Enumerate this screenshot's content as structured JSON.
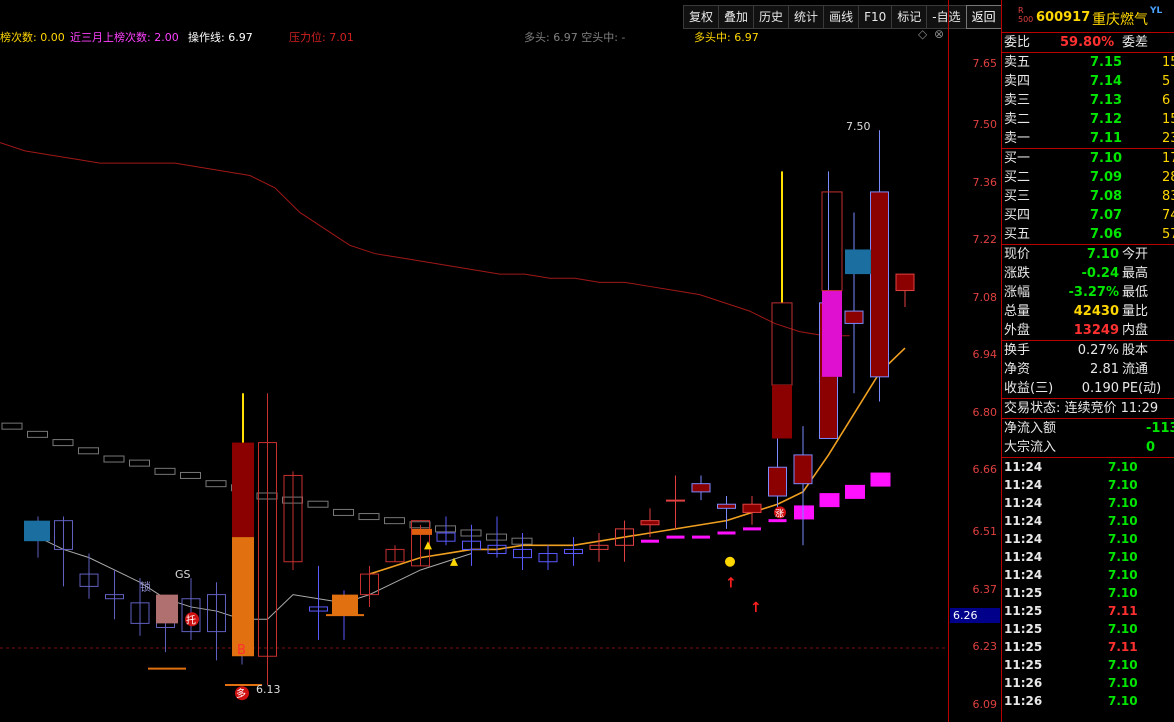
{
  "toolbar": [
    "复权",
    "叠加",
    "历史",
    "统计",
    "画线",
    "F10",
    "标记",
    "-自选",
    "返回"
  ],
  "indicators": [
    {
      "label": "榜次数: 0.00",
      "color": "#ffd700"
    },
    {
      "label": "近三月上榜次数: 2.00",
      "color": "#ff40ff"
    },
    {
      "label": "操作线: 6.97",
      "color": "#ffffff"
    },
    {
      "label": "压力位: 7.01",
      "color": "#d02020"
    },
    {
      "label": "多头: 6.97 空头中: -",
      "color": "#808080"
    },
    {
      "label": "多头中: 6.97",
      "color": "#ffd700"
    }
  ],
  "chart_icons": {
    "expand": "diamond-icon",
    "close": "close-circle-icon"
  },
  "y_axis": [
    "7.65",
    "7.50",
    "7.36",
    "7.22",
    "7.08",
    "6.94",
    "6.80",
    "6.66",
    "6.51",
    "6.37",
    "6.23",
    "6.09"
  ],
  "current_price_label": "6.26",
  "annotations": {
    "high": "7.50",
    "low": "6.13",
    "b_marker": "B",
    "gs_label": "GS",
    "tuo_label": "托",
    "suo_label": "锁",
    "zhang_label": "涨",
    "duo_label": "多"
  },
  "chart_data": {
    "type": "candlestick",
    "ylim": [
      6.05,
      7.7
    ],
    "candles": [
      {
        "o": 6.51,
        "h": 6.55,
        "l": 6.45,
        "c": 6.5
      },
      {
        "o": 6.54,
        "h": 6.55,
        "l": 6.38,
        "c": 6.47
      },
      {
        "o": 6.41,
        "h": 6.46,
        "l": 6.35,
        "c": 6.38
      },
      {
        "o": 6.36,
        "h": 6.42,
        "l": 6.3,
        "c": 6.35
      },
      {
        "o": 6.34,
        "h": 6.4,
        "l": 6.26,
        "c": 6.29
      },
      {
        "o": 6.28,
        "h": 6.35,
        "l": 6.22,
        "c": 6.3
      },
      {
        "o": 6.35,
        "h": 6.4,
        "l": 6.25,
        "c": 6.27
      },
      {
        "o": 6.27,
        "h": 6.39,
        "l": 6.2,
        "c": 6.36
      },
      {
        "o": 6.32,
        "h": 6.35,
        "l": 6.19,
        "c": 6.22
      },
      {
        "o": 6.21,
        "h": 6.85,
        "l": 6.14,
        "c": 6.73
      },
      {
        "o": 6.44,
        "h": 6.66,
        "l": 6.42,
        "c": 6.65
      },
      {
        "o": 6.33,
        "h": 6.43,
        "l": 6.25,
        "c": 6.32
      },
      {
        "o": 6.33,
        "h": 6.37,
        "l": 6.25,
        "c": 6.32
      },
      {
        "o": 6.36,
        "h": 6.43,
        "l": 6.33,
        "c": 6.41
      },
      {
        "o": 6.44,
        "h": 6.48,
        "l": 6.44,
        "c": 6.47
      },
      {
        "o": 6.43,
        "h": 6.53,
        "l": 6.43,
        "c": 6.54
      },
      {
        "o": 6.51,
        "h": 6.55,
        "l": 6.48,
        "c": 6.49
      },
      {
        "o": 6.49,
        "h": 6.53,
        "l": 6.43,
        "c": 6.47
      },
      {
        "o": 6.48,
        "h": 6.55,
        "l": 6.45,
        "c": 6.46
      },
      {
        "o": 6.47,
        "h": 6.51,
        "l": 6.42,
        "c": 6.45
      },
      {
        "o": 6.46,
        "h": 6.48,
        "l": 6.42,
        "c": 6.44
      },
      {
        "o": 6.47,
        "h": 6.5,
        "l": 6.43,
        "c": 6.46
      },
      {
        "o": 6.47,
        "h": 6.51,
        "l": 6.44,
        "c": 6.48
      },
      {
        "o": 6.48,
        "h": 6.54,
        "l": 6.44,
        "c": 6.52
      },
      {
        "o": 6.53,
        "h": 6.57,
        "l": 6.5,
        "c": 6.54
      },
      {
        "o": 6.59,
        "h": 6.65,
        "l": 6.52,
        "c": 6.59
      },
      {
        "o": 6.63,
        "h": 6.65,
        "l": 6.59,
        "c": 6.61
      },
      {
        "o": 6.58,
        "h": 6.6,
        "l": 6.52,
        "c": 6.57
      },
      {
        "o": 6.56,
        "h": 6.6,
        "l": 6.53,
        "c": 6.58
      },
      {
        "o": 6.67,
        "h": 6.75,
        "l": 6.55,
        "c": 6.6
      },
      {
        "o": 6.7,
        "h": 6.77,
        "l": 6.48,
        "c": 6.63
      },
      {
        "o": 7.07,
        "h": 7.39,
        "l": 6.74,
        "c": 6.74
      },
      {
        "o": 7.05,
        "h": 7.29,
        "l": 6.85,
        "c": 7.02
      },
      {
        "o": 7.34,
        "h": 7.49,
        "l": 6.83,
        "c": 6.89
      },
      {
        "o": 7.1,
        "h": 7.13,
        "l": 7.06,
        "c": 7.14
      }
    ],
    "ma_yellow": [
      null,
      null,
      null,
      null,
      null,
      null,
      null,
      null,
      null,
      null,
      null,
      null,
      null,
      6.41,
      6.43,
      6.45,
      6.46,
      6.47,
      6.47,
      6.48,
      6.48,
      6.48,
      6.49,
      6.5,
      6.51,
      6.52,
      6.53,
      6.54,
      6.56,
      6.58,
      6.61,
      6.7,
      6.8,
      6.9,
      6.96
    ],
    "line_white": [
      6.5,
      6.47,
      6.45,
      6.42,
      6.39,
      6.35,
      6.33,
      6.32,
      6.3,
      6.3,
      6.36,
      6.35,
      6.34,
      6.36,
      6.39,
      6.42,
      6.44,
      6.46
    ],
    "ma_red": [
      7.46,
      7.44,
      7.43,
      7.42,
      7.41,
      7.41,
      7.41,
      7.41,
      7.4,
      7.39,
      7.38,
      7.35,
      7.29,
      7.25,
      7.21,
      7.19,
      7.18,
      7.17,
      7.16,
      7.15,
      7.14,
      7.14,
      7.13,
      7.13,
      7.12,
      7.12,
      7.11,
      7.1,
      7.09,
      7.07,
      7.05,
      7.02,
      7.0,
      6.99,
      6.99
    ],
    "ma_gray_steps": [
      6.77,
      6.75,
      6.73,
      6.71,
      6.69,
      6.68,
      6.66,
      6.65,
      6.63,
      6.62,
      6.6,
      6.59,
      6.58,
      6.56,
      6.55,
      6.54,
      6.53,
      6.52,
      6.51,
      6.5,
      6.49
    ],
    "magenta_steps": [
      6.49,
      6.5,
      6.5,
      6.51,
      6.52,
      6.54,
      6.56,
      6.59,
      6.61,
      6.64
    ]
  },
  "panel": {
    "code": "600917",
    "name": "重庆燃气",
    "r500": "R\n500",
    "yl": "YL",
    "weibi": {
      "label": "委比",
      "value": "59.80%",
      "label2": "委差"
    },
    "sells": [
      {
        "label": "卖五",
        "price": "7.15",
        "vol": "15"
      },
      {
        "label": "卖四",
        "price": "7.14",
        "vol": "5"
      },
      {
        "label": "卖三",
        "price": "7.13",
        "vol": "6"
      },
      {
        "label": "卖二",
        "price": "7.12",
        "vol": "15"
      },
      {
        "label": "卖一",
        "price": "7.11",
        "vol": "23"
      }
    ],
    "buys": [
      {
        "label": "买一",
        "price": "7.10",
        "vol": "17"
      },
      {
        "label": "买二",
        "price": "7.09",
        "vol": "28"
      },
      {
        "label": "买三",
        "price": "7.08",
        "vol": "83"
      },
      {
        "label": "买四",
        "price": "7.07",
        "vol": "74"
      },
      {
        "label": "买五",
        "price": "7.06",
        "vol": "57"
      }
    ],
    "quote": [
      {
        "l": "现价",
        "v": "7.10",
        "c": "green",
        "l2": "今开"
      },
      {
        "l": "涨跌",
        "v": "-0.24",
        "c": "green",
        "l2": "最高"
      },
      {
        "l": "涨幅",
        "v": "-3.27%",
        "c": "green",
        "l2": "最低"
      },
      {
        "l": "总量",
        "v": "42430",
        "c": "yellow",
        "l2": "量比"
      },
      {
        "l": "外盘",
        "v": "13249",
        "c": "red",
        "l2": "内盘"
      }
    ],
    "fund": [
      {
        "l": "换手",
        "v": "0.27%",
        "l2": "股本"
      },
      {
        "l": "净资",
        "v": "2.81",
        "l2": "流通"
      },
      {
        "l": "收益(三)",
        "v": "0.190",
        "l2": "PE(动)"
      }
    ],
    "trade_status": "交易状态: 连续竞价 11:29",
    "flow": [
      {
        "l": "净流入额",
        "v": "-113"
      },
      {
        "l": "大宗流入",
        "v": "0"
      }
    ],
    "ticks": [
      {
        "t": "11:24",
        "p": "7.10",
        "c": "green"
      },
      {
        "t": "11:24",
        "p": "7.10",
        "c": "green"
      },
      {
        "t": "11:24",
        "p": "7.10",
        "c": "green"
      },
      {
        "t": "11:24",
        "p": "7.10",
        "c": "green"
      },
      {
        "t": "11:24",
        "p": "7.10",
        "c": "green"
      },
      {
        "t": "11:24",
        "p": "7.10",
        "c": "green"
      },
      {
        "t": "11:24",
        "p": "7.10",
        "c": "green"
      },
      {
        "t": "11:25",
        "p": "7.10",
        "c": "green"
      },
      {
        "t": "11:25",
        "p": "7.11",
        "c": "red"
      },
      {
        "t": "11:25",
        "p": "7.10",
        "c": "green"
      },
      {
        "t": "11:25",
        "p": "7.11",
        "c": "red"
      },
      {
        "t": "11:25",
        "p": "7.10",
        "c": "green"
      },
      {
        "t": "11:26",
        "p": "7.10",
        "c": "green"
      },
      {
        "t": "11:26",
        "p": "7.10",
        "c": "green"
      }
    ]
  }
}
